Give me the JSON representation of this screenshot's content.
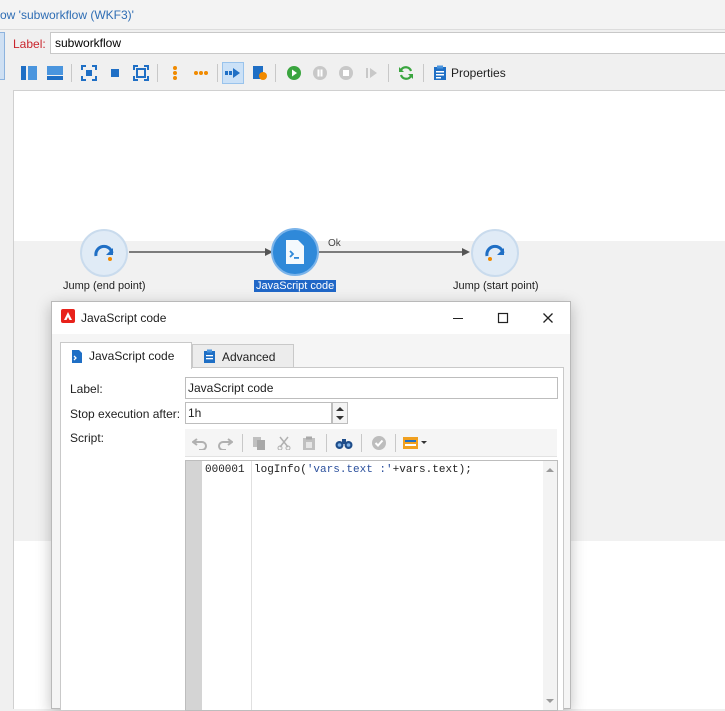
{
  "window": {
    "title": "ow 'subworkflow (WKF3)'"
  },
  "label_row": {
    "label": "Label:",
    "value": "subworkflow"
  },
  "toolbar": {
    "properties_label": "Properties"
  },
  "diagram": {
    "nodes": [
      {
        "label": "Jump (end point)"
      },
      {
        "label": "JavaScript code"
      },
      {
        "label": "Jump (start point)"
      }
    ],
    "transition_label": "Ok"
  },
  "dialog": {
    "title": "JavaScript code",
    "tabs": [
      {
        "label": "JavaScript code"
      },
      {
        "label": "Advanced"
      }
    ],
    "fields": {
      "label_caption": "Label:",
      "label_value": "JavaScript code",
      "stop_caption": "Stop execution after:",
      "stop_value": "1h",
      "script_caption": "Script:"
    },
    "editor": {
      "line_number": "000001",
      "code_prefix": "logInfo(",
      "code_string": "'vars.text :'",
      "code_suffix": "+vars.text);"
    }
  },
  "colors": {
    "accent": "#2f89d9",
    "brand": "#e8221b",
    "label_red": "#c9252d"
  }
}
